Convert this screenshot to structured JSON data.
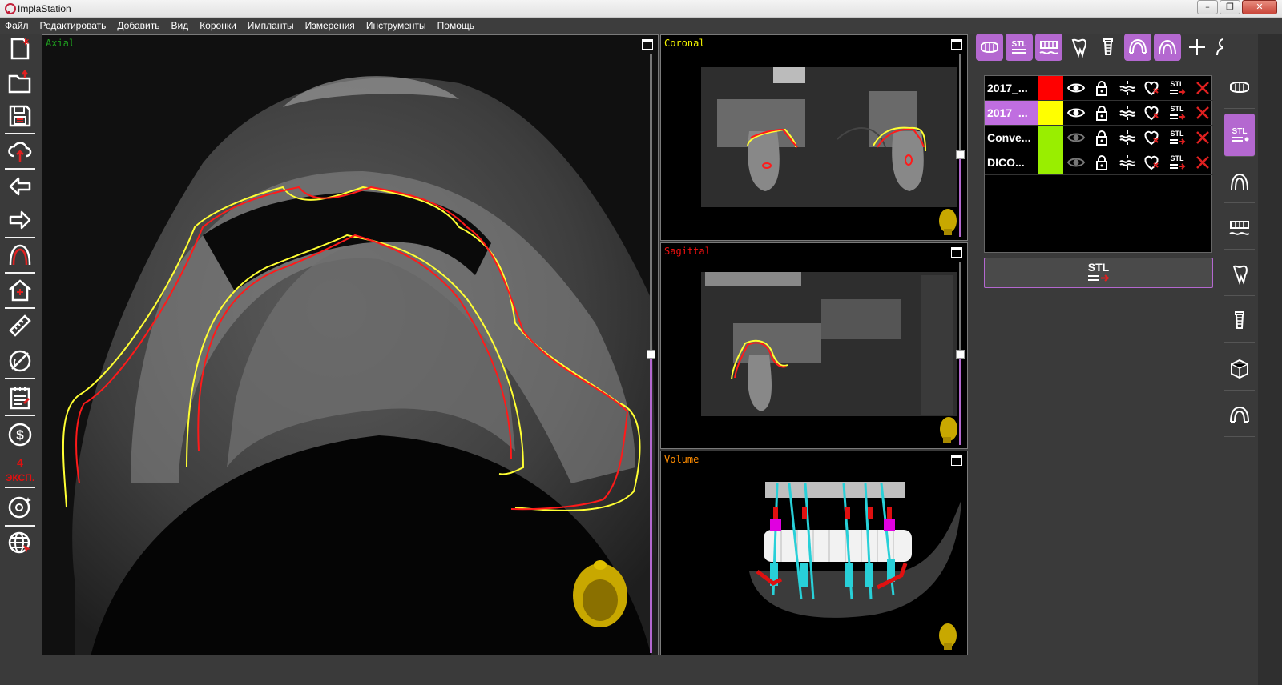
{
  "window": {
    "title": "ImplaStation",
    "minimize_label": "–",
    "restore_label": "❐",
    "close_label": "✕"
  },
  "menu": [
    "Файл",
    "Редактировать",
    "Добавить",
    "Вид",
    "Коронки",
    "Импланты",
    "Измерения",
    "Инструменты",
    "Помощь"
  ],
  "left_toolbar": {
    "export_count": "4",
    "export_label": "ЭКСП."
  },
  "viewports": {
    "axial": {
      "label": "Axial",
      "label_color": "#1fa21f",
      "slice_position": 0.5
    },
    "coronal": {
      "label": "Coronal",
      "label_color": "#f4f400",
      "slice_position": 0.45
    },
    "sagittal": {
      "label": "Sagittal",
      "label_color": "#f41010",
      "slice_position": 0.5
    }
  },
  "volume": {
    "label": "Volume",
    "label_color": "#ff8c00"
  },
  "objects": [
    {
      "name": "2017_...",
      "color": "#ff0000",
      "selected": false,
      "visible": true
    },
    {
      "name": "2017_...",
      "color": "#ffff00",
      "selected": true,
      "visible": true
    },
    {
      "name": "Conve...",
      "color": "#99ee00",
      "selected": false,
      "visible": false
    },
    {
      "name": "DICO...",
      "color": "#99ee00",
      "selected": false,
      "visible": false
    }
  ],
  "object_icon_stl": "STL",
  "stl_button_label": "STL",
  "top_tab_stl_label": "STL",
  "side_tab_stl_label": "STL",
  "colors": {
    "accent": "#b468d0",
    "contour_red": "#ff1a1a",
    "contour_yellow": "#ffff33",
    "implant_cyan": "#28d0d8"
  }
}
